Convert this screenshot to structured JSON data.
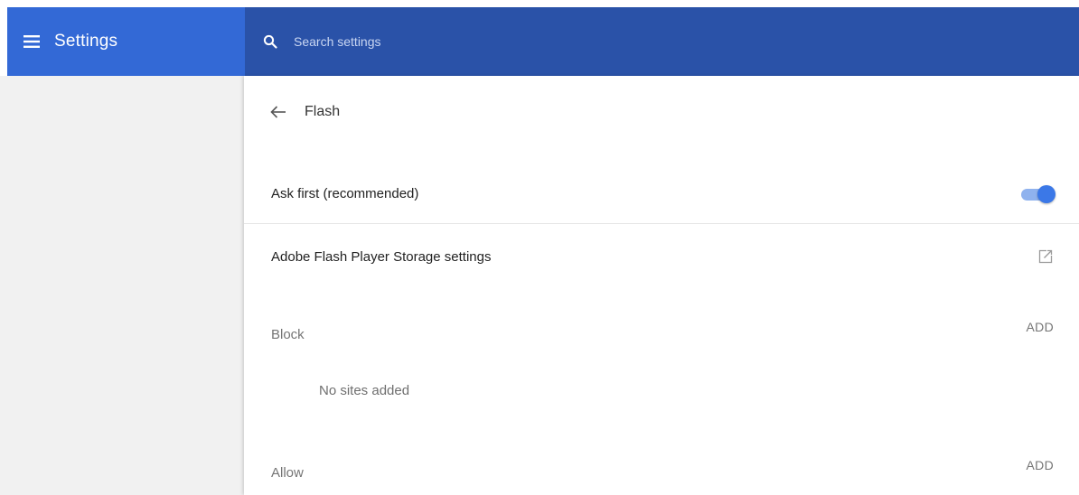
{
  "header": {
    "app_title": "Settings",
    "menu_icon": "hamburger-menu-icon",
    "search_icon": "search-icon",
    "search_placeholder": "Search settings",
    "search_value": "",
    "brand_color": "#3369d6",
    "search_bar_color": "#2a52a8"
  },
  "page": {
    "title": "Flash",
    "back_icon": "arrow-left-icon"
  },
  "settings": {
    "ask_first": {
      "label": "Ask first (recommended)",
      "enabled": true,
      "toggle_color": "#3b78e7"
    },
    "storage": {
      "label": "Adobe Flash Player Storage settings",
      "icon": "external-link-icon"
    }
  },
  "block": {
    "label": "Block",
    "add_label": "ADD",
    "empty_text": "No sites added"
  },
  "allow": {
    "label": "Allow",
    "add_label": "ADD"
  }
}
